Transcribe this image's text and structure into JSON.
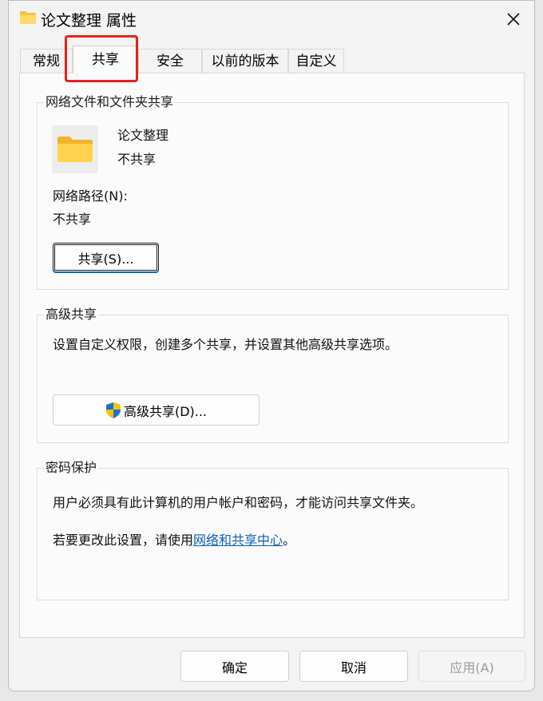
{
  "window": {
    "title": "论文整理 属性"
  },
  "tabs": [
    {
      "label": "常规"
    },
    {
      "label": "共享"
    },
    {
      "label": "安全"
    },
    {
      "label": "以前的版本"
    },
    {
      "label": "自定义"
    }
  ],
  "network_share": {
    "group_label": "网络文件和文件夹共享",
    "folder_name": "论文整理",
    "share_status": "不共享",
    "path_label": "网络路径(N):",
    "path_value": "不共享",
    "share_button": "共享(S)..."
  },
  "advanced_share": {
    "group_label": "高级共享",
    "description": "设置自定义权限，创建多个共享，并设置其他高级共享选项。",
    "button": "高级共享(D)..."
  },
  "password": {
    "group_label": "密码保护",
    "line1": "用户必须具有此计算机的用户帐户和密码，才能访问共享文件夹。",
    "line2_prefix": "若要更改此设置，请使用",
    "line2_link": "网络和共享中心",
    "line2_suffix": "。"
  },
  "footer": {
    "ok": "确定",
    "cancel": "取消",
    "apply": "应用(A)"
  },
  "colors": {
    "highlight": "#e8201a",
    "link": "#0a5fb8",
    "folder": "#f5c342",
    "shield_blue": "#1e6fd0",
    "shield_yellow": "#f5c400"
  }
}
